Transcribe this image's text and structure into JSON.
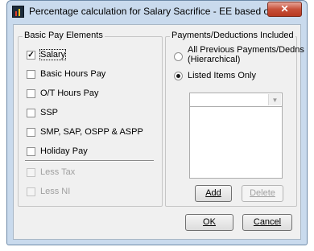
{
  "window": {
    "title": "Percentage calculation for Salary Sacrifice - EE based on...",
    "close_glyph": "✕"
  },
  "basic_pay": {
    "title": "Basic Pay Elements",
    "items": [
      {
        "label": "Salary",
        "checked": true,
        "enabled": true
      },
      {
        "label": "Basic Hours Pay",
        "checked": false,
        "enabled": true
      },
      {
        "label": "O/T Hours Pay",
        "checked": false,
        "enabled": true
      },
      {
        "label": "SSP",
        "checked": false,
        "enabled": true
      },
      {
        "label": "SMP, SAP, OSPP & ASPP",
        "checked": false,
        "enabled": true
      },
      {
        "label": "Holiday Pay",
        "checked": false,
        "enabled": true
      },
      {
        "label": "Less Tax",
        "checked": false,
        "enabled": false
      },
      {
        "label": "Less NI",
        "checked": false,
        "enabled": false
      }
    ]
  },
  "payments": {
    "title": "Payments/Deductions Included",
    "radio_all_line1": "All Previous Payments/Dedns",
    "radio_all_line2": "(Hierarchical)",
    "radio_listed": "Listed Items Only",
    "selected": "listed",
    "combo_value": "",
    "add_label": "Add",
    "delete_label": "Delete"
  },
  "footer": {
    "ok_label": "OK",
    "cancel_label": "Cancel"
  },
  "colors": {
    "frame": "#c9daed",
    "close": "#c7503a"
  }
}
